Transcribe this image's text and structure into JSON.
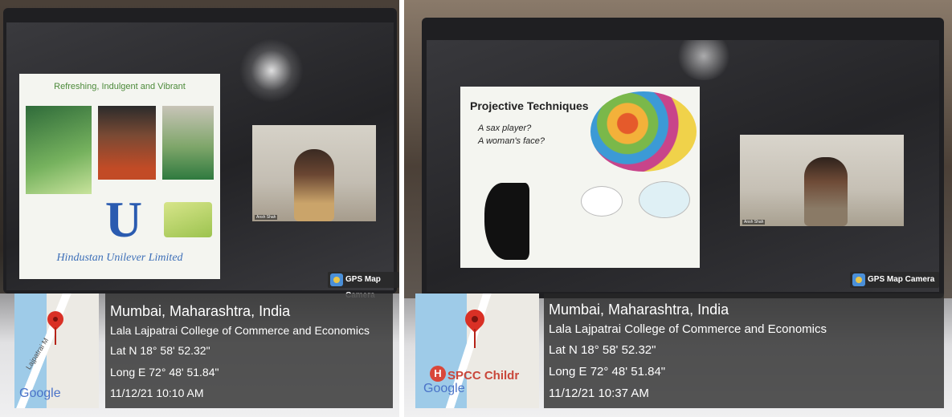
{
  "left": {
    "slide_title": "Refreshing, Indulgent and Vibrant",
    "slide_brand": "Hindustan Unilever Limited",
    "video_name_tag": "Ansh Shah",
    "gps_badge": "GPS Map Camera",
    "city": "Mumbai, Maharashtra, India",
    "college": "Lala Lajpatrai College of Commerce and Economics",
    "lat": "Lat N 18° 58' 52.32\"",
    "long": "Long E 72° 48' 51.84\"",
    "datetime": "11/12/21 10:10 AM",
    "map_road": "Lajpatrai M",
    "map_logo": "Google"
  },
  "right": {
    "slide_title": "Projective Techniques",
    "slide_q1": "A sax player?",
    "slide_q2": "A woman's face?",
    "video_name_tag": "Ansh Shah",
    "gps_badge": "GPS Map Camera",
    "city": "Mumbai, Maharashtra, India",
    "college": "Lala Lajpatrai College of Commerce and Economics",
    "lat": "Lat N 18° 58' 52.32\"",
    "long": "Long E 72° 48' 51.84\"",
    "datetime": "11/12/21 10:37 AM",
    "map_place": "SPCC Childr",
    "map_logo": "Google"
  },
  "colors": {
    "map_pin": "#d93025",
    "map_water": "#9ecbe8",
    "overlay": "#282828"
  }
}
